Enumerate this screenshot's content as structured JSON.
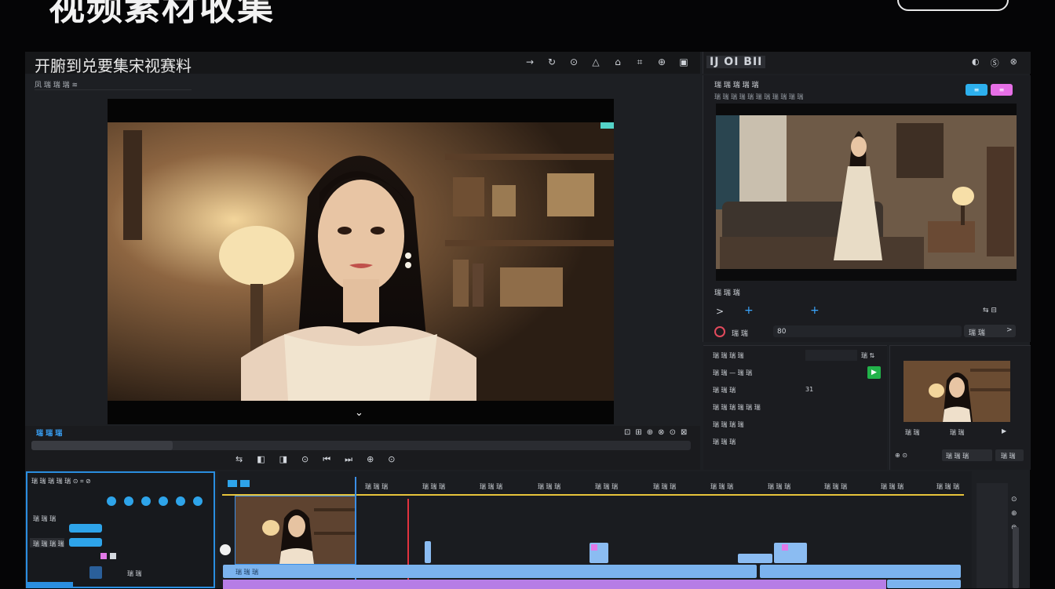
{
  "banner": {
    "title": "视频素材收集"
  },
  "app": {
    "title": "开腑到兑要集宋视赛料",
    "topbar_icons": [
      "→",
      "↻",
      "⊙",
      "△",
      "⌂",
      "⌗",
      "⊕",
      "▣"
    ],
    "right_logo": "IJ OI BII",
    "right_icons": [
      "◐",
      "Ⓢ",
      "⊗"
    ],
    "sub_label": "凤 瑞 瑞 瑞   ≋"
  },
  "right_panel": {
    "title": "瑞 瑞 瑞 瑞 瑞",
    "subtitle": "瑞 瑞 瑞 瑞  瑞   瑞 瑞 瑞   瑞 瑞 瑞",
    "btn_blue": "≡",
    "btn_pink": "≡",
    "section_label": "瑞 瑞 瑞",
    "arrow_left": ">",
    "plus1": "+",
    "plus2": "+",
    "sliders": "⇆ ⊟",
    "record_label": "瑞 瑞",
    "record_value": "80",
    "record_right": "瑞 瑞",
    "record_arrow": ">"
  },
  "props": {
    "row1": "瑞 瑞 瑞 瑞",
    "row1_right": "瑞 ⇅",
    "row2": "瑞 瑞 —   瑞 瑞",
    "row3": "瑞 瑞 瑞",
    "row3_value": "31",
    "row4": "瑞 瑞 瑞 瑞 瑞 瑞",
    "row5": "瑞 瑞 瑞 瑞",
    "row6": "瑞 瑞 瑞",
    "green_btn": "▶"
  },
  "thumb_panel": {
    "label_left": "瑞 瑞",
    "label_mid": "瑞 瑞",
    "play": "▶",
    "foot_left": "⊕ ⊙",
    "foot_mid": "瑞 瑞 瑞",
    "foot_right": "瑞 瑞"
  },
  "controls": {
    "label": "瑞 瑞 瑞",
    "right_icons": [
      "⊡",
      "⊞",
      "⊕",
      "⊗",
      "⊙",
      "⊠"
    ],
    "bottom_icons": [
      "⇆",
      "◧",
      "◨",
      "⊙",
      "⏮",
      "⏭",
      "⊕",
      "⊙"
    ]
  },
  "timeline": {
    "panel_label": "瑞 瑞 瑞 瑞 瑞 ⊙   ⌗   ⊘",
    "ruler_labels": [
      "瑞 瑞 瑞",
      "瑞 瑞 瑞",
      "瑞 瑞 瑞",
      "瑞 瑞 瑞",
      "瑞 瑞 瑞",
      "瑞 瑞 瑞",
      "瑞 瑞 瑞",
      "瑞 瑞 瑞",
      "瑞 瑞 瑞",
      "瑞 瑞 瑞",
      "瑞 瑞 瑞"
    ],
    "left_items": [
      "瑞 瑞 瑞",
      "瑞 瑞 瑞 瑞",
      "瑞 瑞"
    ],
    "blue_track_label": "瑞 瑞 瑞"
  },
  "colors": {
    "accent_blue": "#2db0ee",
    "accent_pink": "#e66fe6",
    "timeline_blue": "#7bb3ee",
    "timeline_purple": "#b67de6",
    "ruler_yellow": "#e7c43b",
    "playhead_red": "#e2333f",
    "record_green": "#22b34a"
  }
}
